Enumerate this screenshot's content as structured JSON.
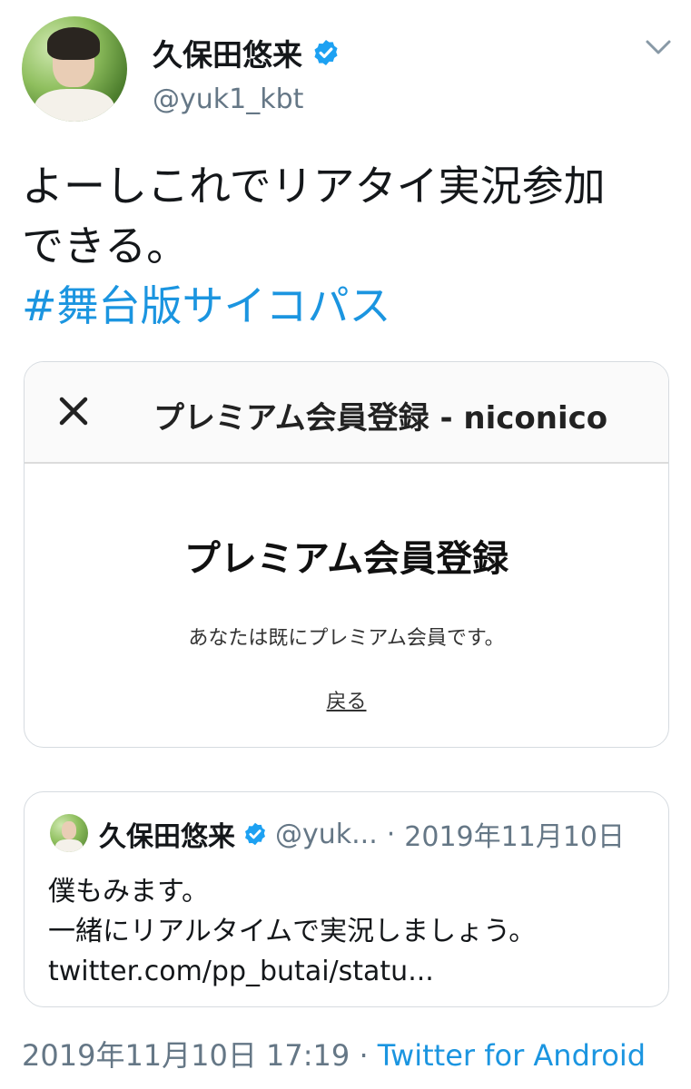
{
  "author": {
    "name": "久保田悠来",
    "handle": "@yuk1_kbt"
  },
  "tweet": {
    "lines": [
      "よーしこれでリアタイ実況参加",
      "できる。"
    ],
    "hashtag": "#舞台版サイコパス"
  },
  "card": {
    "bar_title": "プレミアム会員登録 - niconico",
    "heading": "プレミアム会員登録",
    "message": "あなたは既にプレミアム会員です。",
    "back_link": "戻る"
  },
  "quoted_tweet": {
    "name": "久保田悠来",
    "handle": "@yuk...",
    "separator": "·",
    "date": "2019年11月10日",
    "lines": [
      "僕もみます。",
      "一緒にリアルタイムで実況しましょう。",
      "twitter.com/pp_butai/statu..."
    ]
  },
  "meta": {
    "timestamp": "2019年11月10日 17:19",
    "separator": "·",
    "source": "Twitter for Android"
  },
  "icons": {
    "verified": "verified-badge-icon",
    "menu": "chevron-down-icon",
    "close": "close-icon"
  },
  "colors": {
    "link": "#1b95e0",
    "secondary": "#657786",
    "verified": "#1da1f2"
  }
}
